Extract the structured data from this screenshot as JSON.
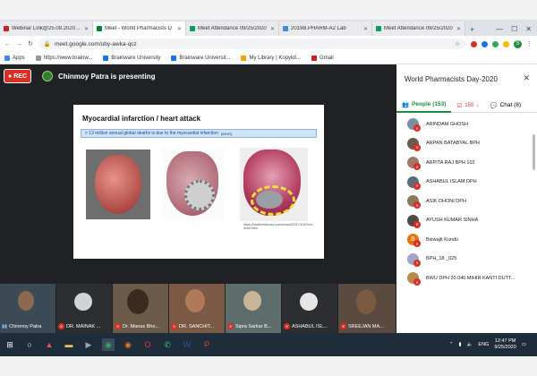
{
  "browser": {
    "tabs": [
      {
        "title": "Webinar Link@25.09.2020_Time",
        "favicon_color": "#c5221f",
        "active": false
      },
      {
        "title": "Meet - World Pharmacists D",
        "favicon_color": "#00832d",
        "active": true
      },
      {
        "title": "Meet Attendance 09/25/2020",
        "favicon_color": "#0f9d58",
        "active": false
      },
      {
        "title": "2019B.PHARM-A2 Lab",
        "favicon_color": "#4285f4",
        "active": false
      },
      {
        "title": "Meet Attendance 09/25/2020",
        "favicon_color": "#0f9d58",
        "active": false
      }
    ],
    "new_tab_label": "+",
    "url": "meet.google.com/uby-awka-qcz",
    "bookmarks": [
      {
        "label": "Apps",
        "color": "#4285f4"
      },
      {
        "label": "https://www.brainw...",
        "color": "#999999"
      },
      {
        "label": "Brainware University",
        "color": "#1a73e8"
      },
      {
        "label": "Brainware Universit...",
        "color": "#1a73e8"
      },
      {
        "label": "My Library | Kopykit...",
        "color": "#f4a300"
      },
      {
        "label": "Gmail",
        "color": "#c5221f"
      }
    ],
    "profile_letter": "S"
  },
  "meet": {
    "rec_label": "REC",
    "presenter_text": "Chinmoy Patra is presenting",
    "slide": {
      "title": "Myocardial infarction / heart attack",
      "bullet": "> 13 million annual global deaths is due to the myocardial infarction",
      "bullet_cite": "(WHO)",
      "caption": "https://healthdictionary.com/tutorial/2017/10/01/mi-heart.html"
    },
    "filmstrip": [
      {
        "name": "Chinmoy Patra",
        "muted": false
      },
      {
        "name": "DR. MAINAK ...",
        "muted": true
      },
      {
        "name": "Dr. Manas Bho...",
        "muted": true
      },
      {
        "name": "DR. SANCHIT...",
        "muted": true
      },
      {
        "name": "Sipra Sarkar B...",
        "muted": true
      },
      {
        "name": "ASHABUL ISL...",
        "muted": true
      },
      {
        "name": "SREEJAN MA...",
        "muted": true
      }
    ]
  },
  "panel": {
    "title": "World Pharmacists Day-2020",
    "tab_people": "People (153)",
    "tab_badge": "150",
    "tab_chat": "Chat (8)",
    "people": [
      {
        "name": "ARINDAM GHOSH",
        "letter": ""
      },
      {
        "name": "ARPAN BATABYAL BPH",
        "letter": ""
      },
      {
        "name": "ARPITA RAJ BPH 102",
        "letter": ""
      },
      {
        "name": "ASHABUL ISLAM DPH",
        "letter": ""
      },
      {
        "name": "ASIK DHONI DPH",
        "letter": ""
      },
      {
        "name": "AYUSH KUMAR SINHA",
        "letter": ""
      },
      {
        "name": "Biswajit Kundu",
        "letter": "B"
      },
      {
        "name": "BPH_18 _025",
        "letter": ""
      },
      {
        "name": "BWU DPH 20.040 MIHIR KANTI DUTT...",
        "letter": ""
      }
    ]
  },
  "taskbar": {
    "language": "ENG",
    "time": "12:47 PM",
    "date": "9/25/2020"
  }
}
